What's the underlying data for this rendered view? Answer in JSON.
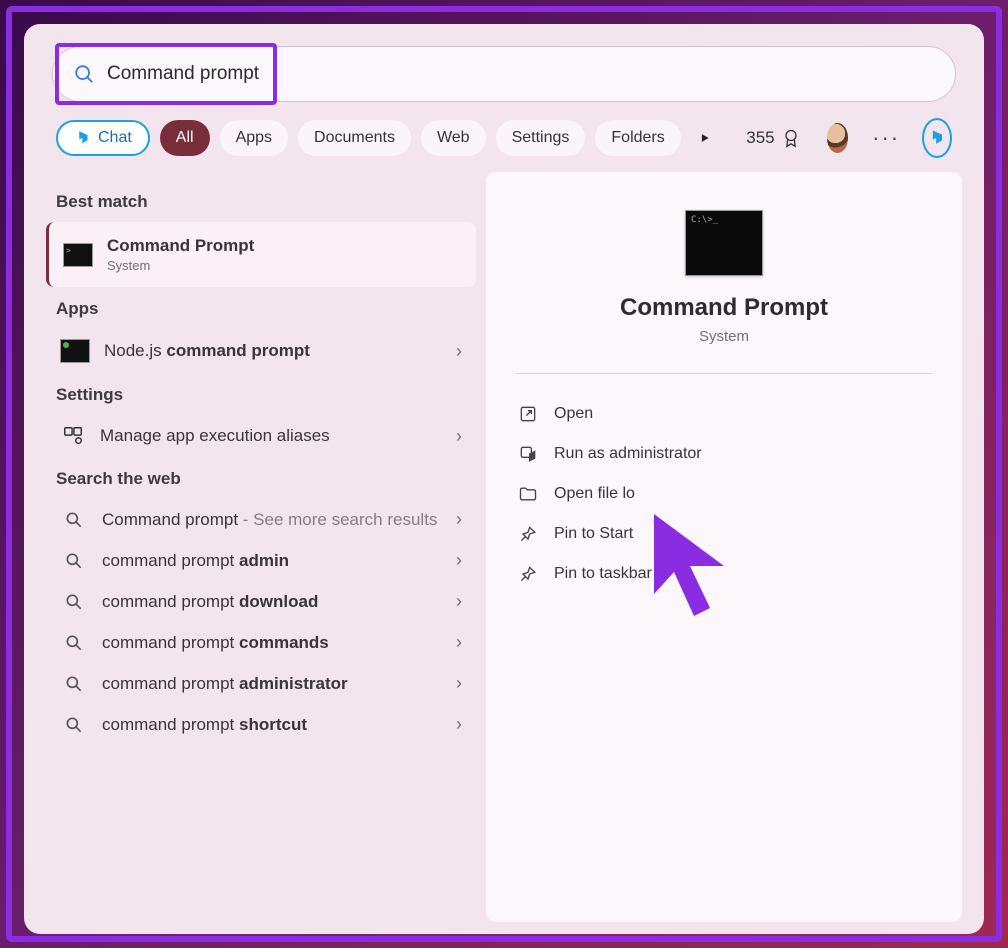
{
  "search": {
    "value": "Command prompt"
  },
  "chips": {
    "chat": "Chat",
    "all": "All",
    "apps": "Apps",
    "documents": "Documents",
    "web": "Web",
    "settings": "Settings",
    "folders": "Folders"
  },
  "points": "355",
  "sections": {
    "best_match": "Best match",
    "apps": "Apps",
    "settings": "Settings",
    "search_web": "Search the web"
  },
  "best": {
    "title": "Command Prompt",
    "subtitle": "System"
  },
  "apps_results": {
    "node_prefix": "Node.js ",
    "node_bold": "command prompt"
  },
  "settings_results": {
    "aliases": "Manage app execution aliases"
  },
  "web_results": {
    "r0_text": "Command prompt",
    "r0_suffix": " - See more search results",
    "r1_text": "command prompt ",
    "r1_bold": "admin",
    "r2_text": "command prompt ",
    "r2_bold": "download",
    "r3_text": "command prompt ",
    "r3_bold": "commands",
    "r4_text": "command prompt ",
    "r4_bold": "administrator",
    "r5_text": "command prompt ",
    "r5_bold": "shortcut"
  },
  "details": {
    "title": "Command Prompt",
    "category": "System"
  },
  "actions": {
    "open": "Open",
    "run_admin": "Run as administrator",
    "open_loc": "Open file lo",
    "pin_start": "Pin to Start",
    "pin_taskbar": "Pin to taskbar"
  }
}
